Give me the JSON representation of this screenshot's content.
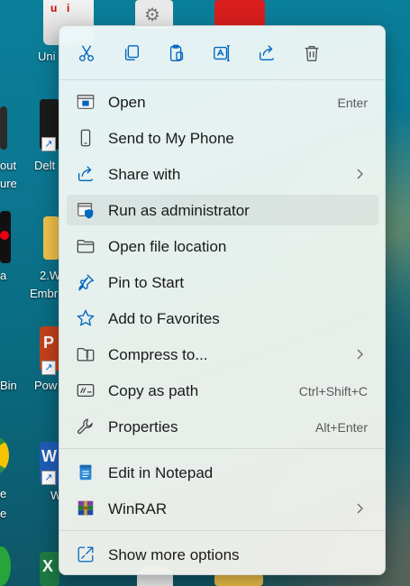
{
  "desktop": {
    "labels": [
      {
        "id": "uni",
        "text": "Uni"
      },
      {
        "id": "out",
        "text": "out"
      },
      {
        "id": "ure",
        "text": "ure"
      },
      {
        "id": "delt",
        "text": "Delt"
      },
      {
        "id": "a",
        "text": "a"
      },
      {
        "id": "two_w",
        "text": "2.W"
      },
      {
        "id": "embr",
        "text": "Embr"
      },
      {
        "id": "bin",
        "text": "Bin"
      },
      {
        "id": "pow",
        "text": "Pow"
      },
      {
        "id": "e",
        "text": "e"
      },
      {
        "id": "e2",
        "text": "e"
      },
      {
        "id": "w",
        "text": "W"
      }
    ]
  },
  "toolbar": {
    "buttons": [
      {
        "name": "cut",
        "icon": "scissors-icon"
      },
      {
        "name": "copy",
        "icon": "copy-icon"
      },
      {
        "name": "paste",
        "icon": "clipboard-icon"
      },
      {
        "name": "rename",
        "icon": "rename-icon"
      },
      {
        "name": "share",
        "icon": "share-icon"
      },
      {
        "name": "delete",
        "icon": "trash-icon"
      }
    ]
  },
  "menu": {
    "items": [
      {
        "label": "Open",
        "shortcut": "Enter",
        "icon": "app-window-icon"
      },
      {
        "label": "Send to My Phone",
        "shortcut": "",
        "icon": "phone-icon"
      },
      {
        "label": "Share with",
        "shortcut": "",
        "icon": "share-with-icon",
        "submenu": true
      },
      {
        "label": "Run as administrator",
        "shortcut": "",
        "icon": "uac-shield-icon"
      },
      {
        "label": "Open file location",
        "shortcut": "",
        "icon": "folder-icon"
      },
      {
        "label": "Pin to Start",
        "shortcut": "",
        "icon": "pin-icon"
      },
      {
        "label": "Add to Favorites",
        "shortcut": "",
        "icon": "star-icon"
      },
      {
        "label": "Compress to...",
        "shortcut": "",
        "icon": "zip-folder-icon",
        "submenu": true
      },
      {
        "label": "Copy as path",
        "shortcut": "Ctrl+Shift+C",
        "icon": "copy-path-icon"
      },
      {
        "label": "Properties",
        "shortcut": "Alt+Enter",
        "icon": "wrench-icon"
      },
      {
        "label": "Edit in Notepad",
        "shortcut": "",
        "icon": "notepad-icon"
      },
      {
        "label": "WinRAR",
        "shortcut": "",
        "icon": "winrar-icon",
        "submenu": true
      },
      {
        "label": "Show more options",
        "shortcut": "",
        "icon": "more-options-icon"
      }
    ]
  },
  "colors": {
    "accent": "#0067c0",
    "menu_text": "#1a1a1a",
    "shortcut_text": "#5a5a5a"
  }
}
